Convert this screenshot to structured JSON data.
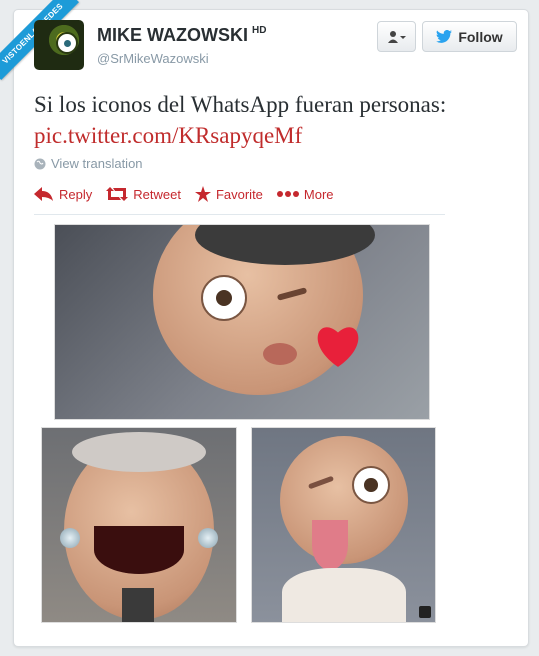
{
  "ribbon": {
    "text": "VISTOENLASREDES",
    "sub": ".com"
  },
  "profile": {
    "name": "MIKE WAZOWSKI",
    "badge": "HD",
    "handle": "@SrMikeWazowski"
  },
  "buttons": {
    "follow": "Follow"
  },
  "tweet": {
    "text": "Si los iconos del WhatsApp fueran personas:",
    "link": "pic.twitter.com/KRsapyqeMf"
  },
  "translate": "View translation",
  "actions": {
    "reply": "Reply",
    "retweet": "Retweet",
    "favorite": "Favorite",
    "more": "More"
  },
  "colors": {
    "accent": "#c5282e",
    "ribbon": "#1d9bd8",
    "link": "#c02c2c"
  },
  "icons": [
    "user-menu-icon",
    "twitter-bird-icon",
    "globe-icon",
    "reply-icon",
    "retweet-icon",
    "star-icon",
    "more-dots-icon",
    "expand-icon"
  ]
}
